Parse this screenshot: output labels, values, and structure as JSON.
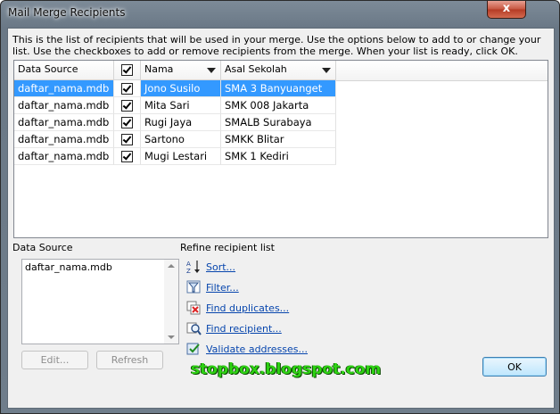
{
  "window": {
    "title": "Mail Merge Recipients",
    "close_label": "x"
  },
  "description": "This is the list of recipients that will be used in your merge.  Use the options below to add to or change your list.  Use the checkboxes to add or remove recipients from the merge.  When your list is ready, click OK.",
  "grid": {
    "columns": [
      "Data Source",
      "",
      "Nama",
      "Asal Sekolah"
    ],
    "rows": [
      {
        "source": "daftar_nama.mdb",
        "checked": true,
        "nama": "Jono Susilo",
        "sekolah": "SMA 3 Banyuanget",
        "selected": true
      },
      {
        "source": "daftar_nama.mdb",
        "checked": true,
        "nama": "Mita Sari",
        "sekolah": "SMK 008 Jakarta",
        "selected": false
      },
      {
        "source": "daftar_nama.mdb",
        "checked": true,
        "nama": "Rugi Jaya",
        "sekolah": "SMALB Surabaya",
        "selected": false
      },
      {
        "source": "daftar_nama.mdb",
        "checked": true,
        "nama": "Sartono",
        "sekolah": "SMKK Blitar",
        "selected": false
      },
      {
        "source": "daftar_nama.mdb",
        "checked": true,
        "nama": "Mugi Lestari",
        "sekolah": "SMK 1 Kediri",
        "selected": false
      }
    ]
  },
  "data_source": {
    "label": "Data Source",
    "items": [
      "daftar_nama.mdb"
    ],
    "edit_label": "Edit...",
    "refresh_label": "Refresh"
  },
  "refine": {
    "label": "Refine recipient list",
    "links": [
      {
        "label": "Sort...",
        "icon": "sort-az-icon"
      },
      {
        "label": "Filter...",
        "icon": "filter-icon"
      },
      {
        "label": "Find duplicates...",
        "icon": "find-duplicates-icon"
      },
      {
        "label": "Find recipient...",
        "icon": "find-recipient-icon"
      },
      {
        "label": "Validate addresses...",
        "icon": "validate-addresses-icon"
      }
    ]
  },
  "watermark": "stopbox.blogspot.com",
  "ok_label": "OK",
  "colors": {
    "selection": "#3399ff",
    "link": "#0645ad",
    "watermark": "#2ed313"
  }
}
